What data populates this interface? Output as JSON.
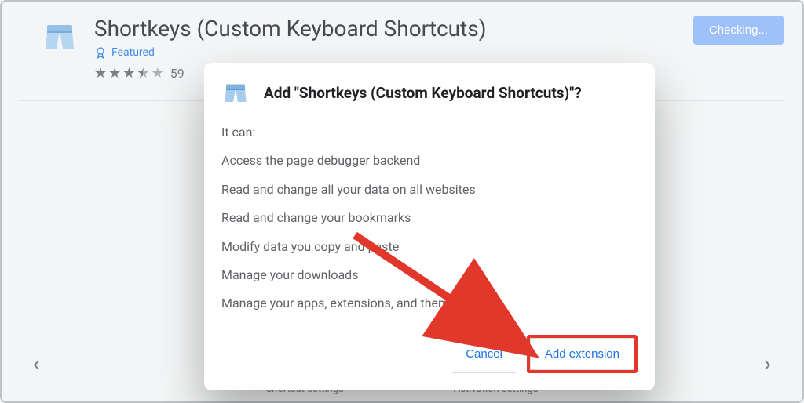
{
  "header": {
    "title": "Shortkeys (Custom Keyboard Shortcuts)",
    "featured_label": "Featured",
    "rating": 3.5,
    "rating_count_partial": "59",
    "checking_label": "Checking..."
  },
  "carousel": {
    "prev": "‹",
    "next": "›",
    "captions": [
      "Shortcut settings",
      "Activation settings"
    ]
  },
  "modal": {
    "title": "Add \"Shortkeys (Custom Keyboard Shortcuts)\"?",
    "intro": "It can:",
    "permissions": [
      "Access the page debugger backend",
      "Read and change all your data on all websites",
      "Read and change your bookmarks",
      "Modify data you copy and paste",
      "Manage your downloads",
      "Manage your apps, extensions, and themes"
    ],
    "cancel_label": "Cancel",
    "confirm_label": "Add extension"
  }
}
